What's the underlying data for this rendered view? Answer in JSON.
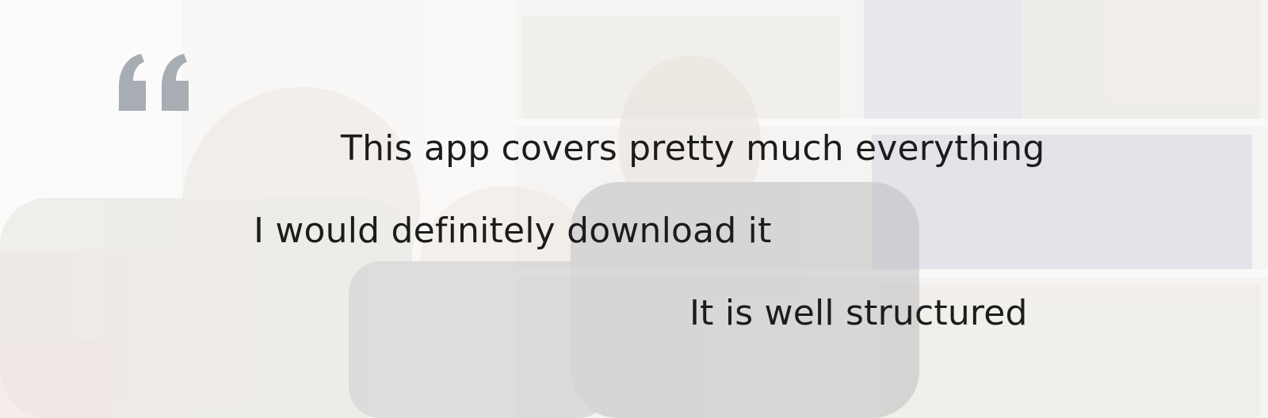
{
  "banner": {
    "quote_icon": "quotation-mark-icon",
    "quote_color": "#a8adb4",
    "testimonials": [
      "This app covers pretty much everything",
      "I would definitely download it",
      "It is well structured"
    ]
  }
}
